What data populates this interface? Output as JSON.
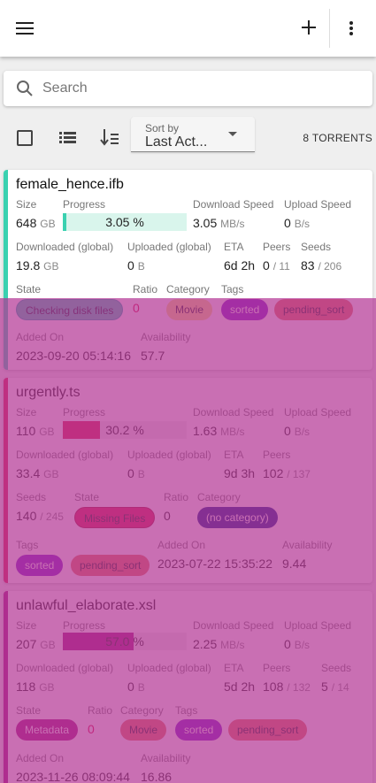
{
  "appbar": {
    "menu_icon": "menu-icon",
    "add_icon": "plus-icon",
    "more_icon": "more-vert-icon"
  },
  "search": {
    "placeholder": "Search",
    "value": ""
  },
  "toolbar": {
    "sort_by_label": "Sort by",
    "sort_by_value": "Last Act...",
    "torrent_count": "8 TORRENTS"
  },
  "colors": {
    "overlay": "#b4379699",
    "downloading": "#3ad1b0",
    "error": "#dc1b4b",
    "metadata": "#a0157f"
  },
  "labels": {
    "size": "Size",
    "progress": "Progress",
    "download_speed": "Download Speed",
    "upload_speed": "Upload Speed",
    "downloaded_global": "Downloaded (global)",
    "uploaded_global": "Uploaded (global)",
    "eta": "ETA",
    "peers": "Peers",
    "seeds": "Seeds",
    "state": "State",
    "ratio": "Ratio",
    "category": "Category",
    "tags": "Tags",
    "added_on": "Added On",
    "availability": "Availability"
  },
  "torrents": [
    {
      "name": "female_hence.ifb",
      "size": "648",
      "size_unit": "GB",
      "progress": 0.0305,
      "progress_text": "3.05 %",
      "download_speed": "3.05",
      "download_speed_unit": "MB/s",
      "upload_speed": "0",
      "upload_speed_unit": "B/s",
      "downloaded": "19.8",
      "downloaded_unit": "GB",
      "uploaded": "0",
      "uploaded_unit": "B",
      "eta": "6d 2h",
      "peers": "0",
      "peers_total": "/ 11",
      "seeds": "83",
      "seeds_total": "/ 206",
      "state": "Checking disk files",
      "ratio": "0",
      "category": "Movie",
      "tags": [
        "sorted",
        "pending_sort"
      ],
      "added_on": "2023-09-20 05:14:16",
      "availability": "57.7"
    },
    {
      "name": "urgently.ts",
      "size": "110",
      "size_unit": "GB",
      "progress": 0.302,
      "progress_text": "30.2 %",
      "download_speed": "1.63",
      "download_speed_unit": "MB/s",
      "upload_speed": "0",
      "upload_speed_unit": "B/s",
      "downloaded": "33.4",
      "downloaded_unit": "GB",
      "uploaded": "0",
      "uploaded_unit": "B",
      "eta": "9d 3h",
      "peers": "102",
      "peers_total": "/ 137",
      "seeds": "140",
      "seeds_total": "/ 245",
      "state": "Missing Files",
      "ratio": "0",
      "category": "(no category)",
      "tags": [
        "sorted",
        "pending_sort"
      ],
      "added_on": "2023-07-22 15:35:22",
      "availability": "9.44"
    },
    {
      "name": "unlawful_elaborate.xsl",
      "size": "207",
      "size_unit": "GB",
      "progress": 0.57,
      "progress_text": "57.0 %",
      "download_speed": "2.25",
      "download_speed_unit": "MB/s",
      "upload_speed": "0",
      "upload_speed_unit": "B/s",
      "downloaded": "118",
      "downloaded_unit": "GB",
      "uploaded": "0",
      "uploaded_unit": "B",
      "eta": "5d 2h",
      "peers": "108",
      "peers_total": "/ 132",
      "seeds": "5",
      "seeds_total": "/ 14",
      "state": "Metadata",
      "ratio": "0",
      "category": "Movie",
      "tags": [
        "sorted",
        "pending_sort"
      ],
      "added_on": "2023-11-26 08:09:44",
      "availability": "16.86"
    }
  ]
}
